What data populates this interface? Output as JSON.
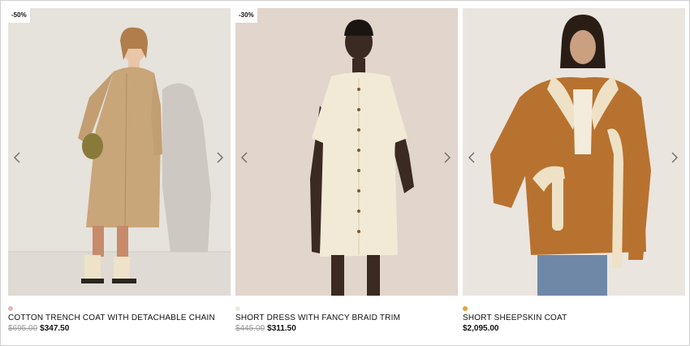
{
  "products": [
    {
      "badge": "-50%",
      "name": "COTTON TRENCH COAT WITH DETACHABLE CHAIN",
      "old_price": "$695.00",
      "price": "$347.50",
      "swatch_color": "#e7b6b0"
    },
    {
      "badge": "-30%",
      "name": "SHORT DRESS WITH FANCY BRAID TRIM",
      "old_price": "$445.00",
      "price": "$311.50",
      "swatch_color": "#ece9dc"
    },
    {
      "badge": "",
      "name": "SHORT SHEEPSKIN COAT",
      "old_price": "",
      "price": "$2,095.00",
      "swatch_color": "#e5a43a"
    }
  ],
  "icons": {
    "prev": "chevron-left-icon",
    "next": "chevron-right-icon"
  }
}
